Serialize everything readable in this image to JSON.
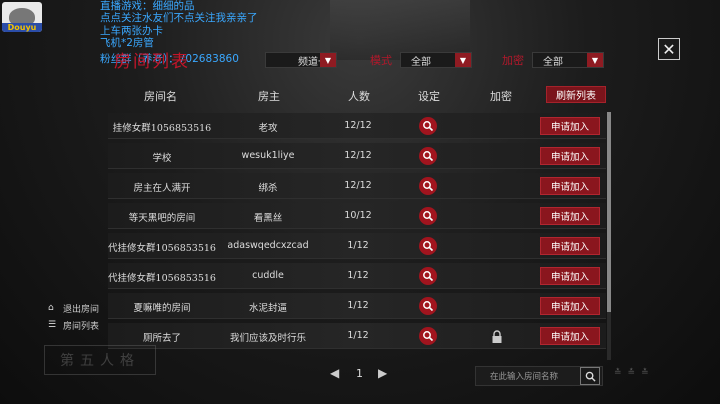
{
  "stream_overlay": {
    "lines": [
      "直播游戏：细细的品",
      "点点关注水友们不点关注我亲亲了",
      "上车两张办卡",
      "飞机*2房管"
    ],
    "fans": "粉丝群（养老）：702683860",
    "logo_text": "Douyu"
  },
  "title": "房间列表",
  "filters": {
    "channel_label": "频道",
    "channel_value": "频道一",
    "mode_label": "模式",
    "mode_value": "全部",
    "lock_label": "加密",
    "lock_value": "全部"
  },
  "columns": {
    "room_name": "房间名",
    "owner": "房主",
    "count": "人数",
    "settings": "设定",
    "encrypted": "加密",
    "refresh": "刷新列表"
  },
  "rows": [
    {
      "name": "挂修女群1056853516",
      "owner": "老攻",
      "count": "12/12",
      "locked": false,
      "join": "申请加入"
    },
    {
      "name": "学校",
      "owner": "wesuk1liye",
      "count": "12/12",
      "locked": false,
      "join": "申请加入"
    },
    {
      "name": "房主在人满开",
      "owner": "绑杀",
      "count": "12/12",
      "locked": false,
      "join": "申请加入"
    },
    {
      "name": "等天黑吧的房间",
      "owner": "看黑丝",
      "count": "10/12",
      "locked": false,
      "join": "申请加入"
    },
    {
      "name": "代挂修女群1056853516",
      "owner": "adaswqedcxzcad",
      "count": "1/12",
      "locked": false,
      "join": "申请加入"
    },
    {
      "name": "代挂修女群1056853516",
      "owner": "cuddle",
      "count": "1/12",
      "locked": false,
      "join": "申请加入"
    },
    {
      "name": "夏嘛唯的房间",
      "owner": "水泥封逼",
      "count": "1/12",
      "locked": false,
      "join": "申请加入"
    },
    {
      "name": "厕所去了",
      "owner": "我们应该及时行乐",
      "count": "1/12",
      "locked": true,
      "join": "申请加入"
    }
  ],
  "left_menu": {
    "exit_room": "退出房间",
    "room_list": "房间列表"
  },
  "stamp_text": "第五人格",
  "pager": {
    "page": "1",
    "prev": "◀",
    "next": "▶"
  },
  "search": {
    "placeholder": "在此输入房间名称"
  },
  "bottom_icons": "≛≛≛"
}
